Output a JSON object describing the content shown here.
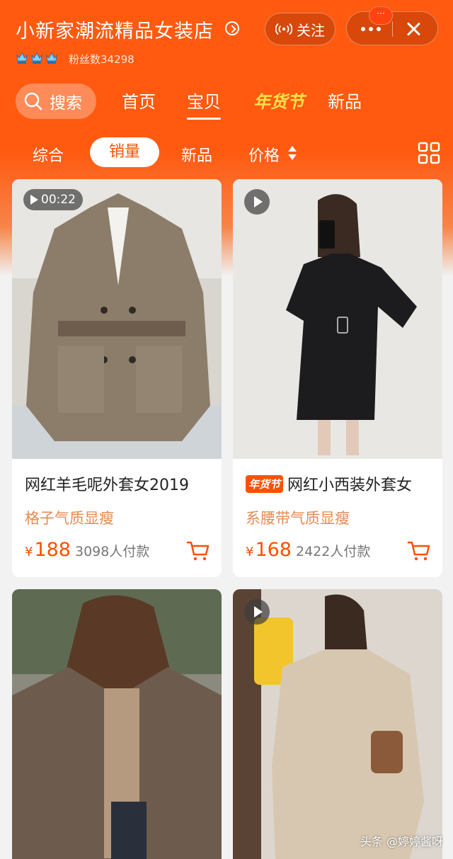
{
  "store": {
    "name": "小新家潮流精品女装店",
    "fans": "粉丝数34298",
    "follow_label": "关注",
    "notification_badge": "···",
    "crowns": [
      "crown-icon",
      "crown-icon",
      "crown-icon"
    ]
  },
  "nav": {
    "search_label": "搜索",
    "tabs": [
      "首页",
      "宝贝",
      "年货节",
      "新品"
    ],
    "active_tab": "宝贝"
  },
  "sort": {
    "items": [
      "综合",
      "销量",
      "新品",
      "价格"
    ],
    "active": "销量"
  },
  "products": [
    {
      "video_time": "00:22",
      "title": "网红羊毛呢外套女2019",
      "subtitle": "格子气质显瘦",
      "currency": "¥",
      "price": "188",
      "sales": "3098人付款"
    },
    {
      "badge": "年货节",
      "title": "网红小西装外套女",
      "subtitle": "系腰带气质显瘦",
      "currency": "¥",
      "price": "168",
      "sales": "2422人付款"
    }
  ],
  "watermark": "头条 @婷婷酱呀",
  "colors": {
    "brand": "#ff5000",
    "festival": "#ffe14a",
    "subtitle": "#e58a52"
  }
}
